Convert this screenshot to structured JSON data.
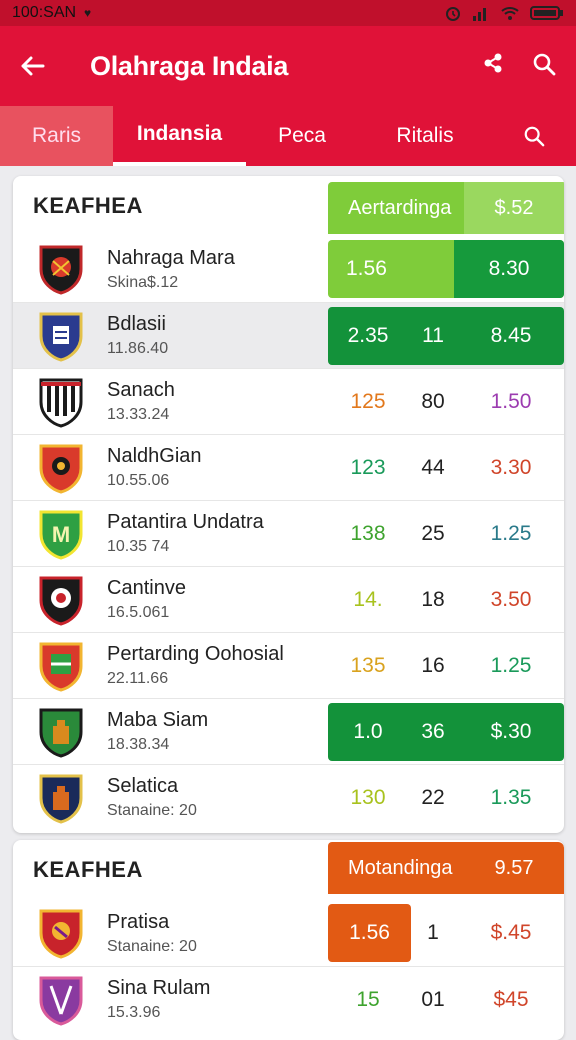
{
  "status_bar": {
    "time": "100:SAN"
  },
  "app_bar": {
    "title": "Olahraga Indaia"
  },
  "tabs": [
    "Raris",
    "Indansia",
    "Peca",
    "Ritalis"
  ],
  "colors": {
    "primary": "#e01238",
    "green": "#13923a",
    "light_green": "#7fcc3a",
    "orange": "#e25a14"
  },
  "section1": {
    "name": "KEAFHEA",
    "header_label": "Aertardinga",
    "header_value": "$.52",
    "rows": [
      {
        "name": "Nahraga Mara",
        "sub": "Skina$.12",
        "v1": "1.56",
        "v2": "",
        "v3": "8.30"
      },
      {
        "name": "Bdlasii",
        "sub": "11.86.40",
        "v1": "2.35",
        "v2": "11",
        "v3": "8.45"
      },
      {
        "name": "Sanach",
        "sub": "13.33.24",
        "v1": "125",
        "v2": "80",
        "v3": "1.50"
      },
      {
        "name": "NaldhGian",
        "sub": "10.55.06",
        "v1": "123",
        "v2": "44",
        "v3": "3.30"
      },
      {
        "name": "Patantira Undatra",
        "sub": "10.35 74",
        "v1": "138",
        "v2": "25",
        "v3": "1.25"
      },
      {
        "name": "Cantinve",
        "sub": "16.5.061",
        "v1": "14.",
        "v2": "18",
        "v3": "3.50"
      },
      {
        "name": "Pertarding Oohosial",
        "sub": "22.11.66",
        "v1": "135",
        "v2": "16",
        "v3": "1.25"
      },
      {
        "name": "Maba Siam",
        "sub": "18.38.34",
        "v1": "1.0",
        "v2": "36",
        "v3": "$.30"
      },
      {
        "name": "Selatica",
        "sub": "Stanaine: 20",
        "v1": "130",
        "v2": "22",
        "v3": "1.35"
      }
    ]
  },
  "section2": {
    "name": "KEAFHEA",
    "header_label": "Motandinga",
    "header_value": "9.57",
    "rows": [
      {
        "name": "Pratisa",
        "sub": "Stanaine: 20",
        "v1": "1.56",
        "v2": "1",
        "v3": "$.45"
      },
      {
        "name": "Sina Rulam",
        "sub": "15.3.96",
        "v1": "15",
        "v2": "01",
        "v3": "$45"
      }
    ]
  }
}
